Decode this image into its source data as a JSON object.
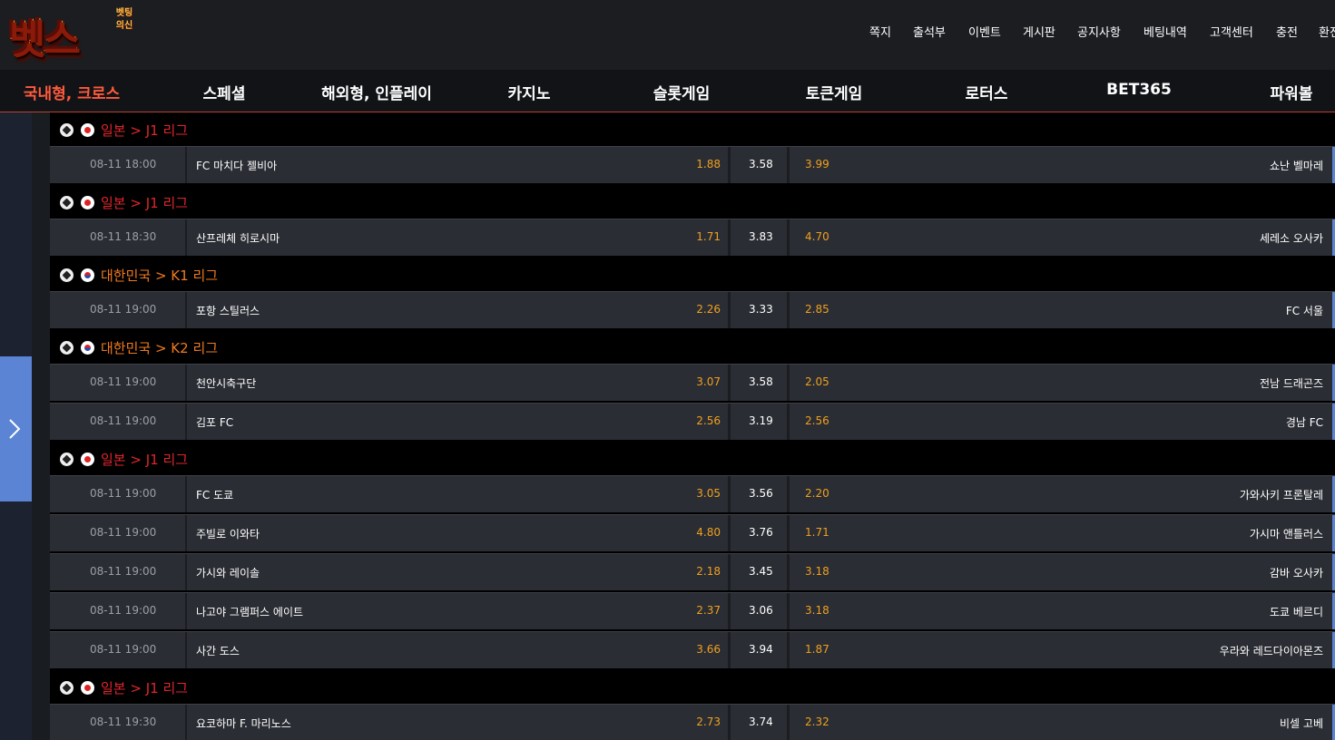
{
  "logo": {
    "main": "벳스",
    "sub": "벳팅의신"
  },
  "topnav": [
    "쪽지",
    "출석부",
    "이벤트",
    "게시판",
    "공지사항",
    "베팅내역",
    "고객센터",
    "충전",
    "환전"
  ],
  "categories": [
    "국내형, 크로스",
    "스페셜",
    "해외형, 인플레이",
    "카지노",
    "슬롯게임",
    "토큰게임",
    "로터스",
    "BET365",
    "파워볼"
  ],
  "sections": [
    {
      "league": "일본 > J1 리그",
      "color": "red",
      "flag": "jp",
      "matches": [
        {
          "time": "08-11 18:00",
          "home": "FC 마치다 젤비아",
          "odd1": "1.88",
          "draw": "3.58",
          "odd2": "3.99",
          "away": "쇼난 벨마레"
        }
      ]
    },
    {
      "league": "일본 > J1 리그",
      "color": "red",
      "flag": "jp",
      "matches": [
        {
          "time": "08-11 18:30",
          "home": "산프레체 히로시마",
          "odd1": "1.71",
          "draw": "3.83",
          "odd2": "4.70",
          "away": "세레소 오사카"
        }
      ]
    },
    {
      "league": "대한민국 > K1 리그",
      "color": "orange",
      "flag": "kr",
      "matches": [
        {
          "time": "08-11 19:00",
          "home": "포항 스틸러스",
          "odd1": "2.26",
          "draw": "3.33",
          "odd2": "2.85",
          "away": "FC 서울"
        }
      ]
    },
    {
      "league": "대한민국 > K2 리그",
      "color": "orange",
      "flag": "kr",
      "matches": [
        {
          "time": "08-11 19:00",
          "home": "천안시축구단",
          "odd1": "3.07",
          "draw": "3.58",
          "odd2": "2.05",
          "away": "전남 드래곤즈"
        },
        {
          "time": "08-11 19:00",
          "home": "김포 FC",
          "odd1": "2.56",
          "draw": "3.19",
          "odd2": "2.56",
          "away": "경남 FC"
        }
      ]
    },
    {
      "league": "일본 > J1 리그",
      "color": "red",
      "flag": "jp",
      "matches": [
        {
          "time": "08-11 19:00",
          "home": "FC 도쿄",
          "odd1": "3.05",
          "draw": "3.56",
          "odd2": "2.20",
          "away": "가와사키 프론탈레"
        },
        {
          "time": "08-11 19:00",
          "home": "주빌로 이와타",
          "odd1": "4.80",
          "draw": "3.76",
          "odd2": "1.71",
          "away": "가시마 앤틀러스"
        },
        {
          "time": "08-11 19:00",
          "home": "가시와 레이솔",
          "odd1": "2.18",
          "draw": "3.45",
          "odd2": "3.18",
          "away": "감바 오사카"
        },
        {
          "time": "08-11 19:00",
          "home": "나고야 그램퍼스 에이트",
          "odd1": "2.37",
          "draw": "3.06",
          "odd2": "3.18",
          "away": "도쿄 베르디"
        },
        {
          "time": "08-11 19:00",
          "home": "사간 도스",
          "odd1": "3.66",
          "draw": "3.94",
          "odd2": "1.87",
          "away": "우라와 레드다이아몬즈"
        }
      ]
    },
    {
      "league": "일본 > J1 리그",
      "color": "red",
      "flag": "jp",
      "matches": [
        {
          "time": "08-11 19:30",
          "home": "요코하마 F. 마리노스",
          "odd1": "2.73",
          "draw": "3.74",
          "odd2": "2.32",
          "away": "비셀 고베"
        }
      ]
    }
  ]
}
